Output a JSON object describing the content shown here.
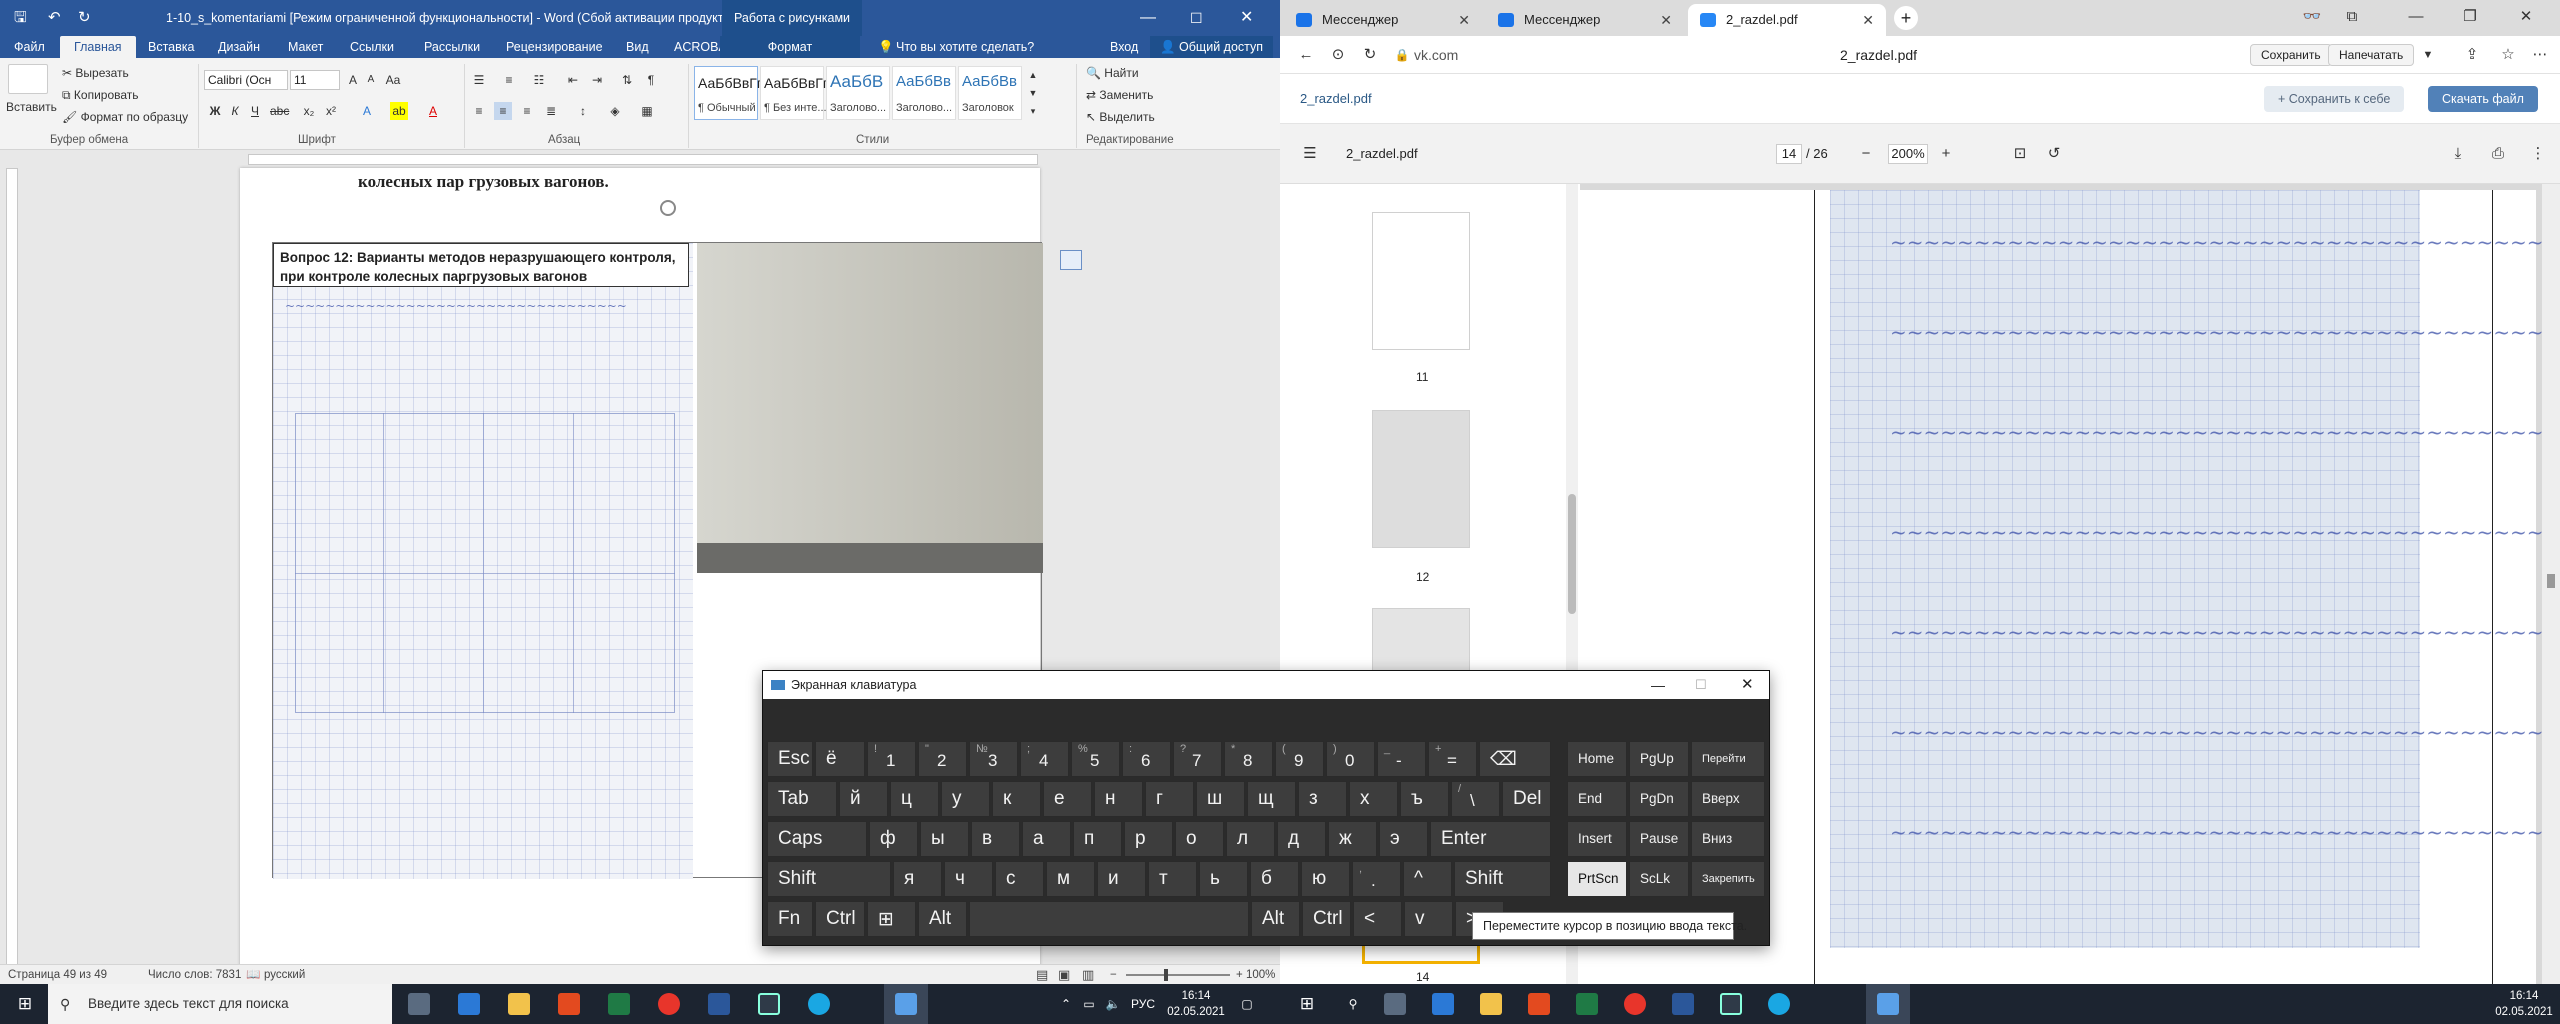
{
  "word": {
    "title": "1-10_s_komentariami [Режим ограниченной функциональности] - Word (Сбой активации продукта)",
    "context_tab": "Работа с рисунками",
    "context_format": "Формат",
    "tell_me": "Что вы хотите сделать?",
    "login": "Вход",
    "share": "Общий доступ",
    "tabs": [
      "Файл",
      "Главная",
      "Вставка",
      "Дизайн",
      "Макет",
      "Ссылки",
      "Рассылки",
      "Рецензирование",
      "Вид",
      "ACROBAT"
    ],
    "clipboard": {
      "paste": "Вставить",
      "cut": "Вырезать",
      "copy": "Копировать",
      "format_painter": "Формат по образцу",
      "group": "Буфер обмена"
    },
    "font": {
      "name": "Calibri (Осн",
      "size": "11",
      "group": "Шрифт"
    },
    "paragraph_group": "Абзац",
    "styles": {
      "items": [
        {
          "preview": "АаБбВвГг,",
          "name": "¶ Обычный"
        },
        {
          "preview": "АаБбВвГг,",
          "name": "¶ Без инте..."
        },
        {
          "preview": "АаБбВ",
          "name": "Заголово..."
        },
        {
          "preview": "АаБбВв",
          "name": "Заголово..."
        },
        {
          "preview": "АаБбВв",
          "name": "Заголовок"
        }
      ],
      "group": "Стили"
    },
    "editing": {
      "find": "Найти",
      "replace": "Заменить",
      "select": "Выделить",
      "group": "Редактирование"
    },
    "doc": {
      "heading": "колесных пар грузовых вагонов.",
      "box_text": "Вопрос  12: Варианты методов неразрушающего контроля, при контроле  колесных паргрузовых вагонов"
    },
    "status": {
      "page": "Страница 49 из 49",
      "words": "Число слов: 7831",
      "lang": "русский",
      "zoom": "100%"
    }
  },
  "edge": {
    "tabs": [
      {
        "label": "Мессенджер"
      },
      {
        "label": "Мессенджер"
      },
      {
        "label": "2_razdel.pdf"
      }
    ],
    "url": "vk.com",
    "page_title": "2_razdel.pdf",
    "save": "Сохранить",
    "print": "Напечатать",
    "vk_file": "2_razdel.pdf",
    "save_to_self": "Сохранить к себе",
    "download": "Скачать файл",
    "pdf": {
      "name": "2_razdel.pdf",
      "page": "14",
      "total": "/ 26",
      "zoom": "200%"
    },
    "thumbs": [
      "11",
      "12",
      "14"
    ]
  },
  "osk": {
    "title": "Экранная клавиатура",
    "row1": [
      {
        "m": "Esc"
      },
      {
        "m": "ё"
      },
      {
        "s": "!",
        "m": "1"
      },
      {
        "s": "\"",
        "m": "2"
      },
      {
        "s": "№",
        "m": "3"
      },
      {
        "s": ";",
        "m": "4"
      },
      {
        "s": "%",
        "m": "5"
      },
      {
        "s": ":",
        "m": "6"
      },
      {
        "s": "?",
        "m": "7"
      },
      {
        "s": "*",
        "m": "8"
      },
      {
        "s": "(",
        "m": "9"
      },
      {
        "s": ")",
        "m": "0"
      },
      {
        "s": "_",
        "m": "-"
      },
      {
        "s": "+",
        "m": "="
      },
      {
        "m": "⌫"
      }
    ],
    "row2": [
      {
        "m": "Tab"
      },
      {
        "m": "й"
      },
      {
        "m": "ц"
      },
      {
        "m": "у"
      },
      {
        "m": "к"
      },
      {
        "m": "е"
      },
      {
        "m": "н"
      },
      {
        "m": "г"
      },
      {
        "m": "ш"
      },
      {
        "m": "щ"
      },
      {
        "m": "з"
      },
      {
        "m": "х"
      },
      {
        "m": "ъ"
      },
      {
        "s": "/",
        "m": "\\"
      },
      {
        "m": "Del"
      }
    ],
    "row3": [
      {
        "m": "Caps"
      },
      {
        "m": "ф"
      },
      {
        "m": "ы"
      },
      {
        "m": "в"
      },
      {
        "m": "а"
      },
      {
        "m": "п"
      },
      {
        "m": "р"
      },
      {
        "m": "о"
      },
      {
        "m": "л"
      },
      {
        "m": "д"
      },
      {
        "m": "ж"
      },
      {
        "m": "э"
      },
      {
        "m": "Enter"
      }
    ],
    "row4": [
      {
        "m": "Shift"
      },
      {
        "m": "я"
      },
      {
        "m": "ч"
      },
      {
        "m": "с"
      },
      {
        "m": "м"
      },
      {
        "m": "и"
      },
      {
        "m": "т"
      },
      {
        "m": "ь"
      },
      {
        "m": "б"
      },
      {
        "m": "ю"
      },
      {
        "s": ",",
        "m": "."
      },
      {
        "m": "^"
      },
      {
        "m": "Shift"
      }
    ],
    "row5": [
      {
        "m": "Fn"
      },
      {
        "m": "Ctrl"
      },
      {
        "m": "⊞"
      },
      {
        "m": "Alt"
      },
      {
        "m": ""
      },
      {
        "m": "Alt"
      },
      {
        "m": "Ctrl"
      },
      {
        "m": "<"
      },
      {
        "m": "v"
      },
      {
        "m": ">"
      }
    ],
    "nav": [
      [
        "Home",
        "PgUp",
        "Перейти"
      ],
      [
        "End",
        "PgDn",
        "Вверх"
      ],
      [
        "Insert",
        "Pause",
        "Вниз"
      ],
      [
        "PrtScn",
        "ScLk",
        "Закрепить"
      ]
    ],
    "tooltip": "Переместите курсор в позицию ввода текста."
  },
  "taskbar": {
    "search": "Введите здесь текст для поиска",
    "lang": "РУС",
    "time": "16:14",
    "date": "02.05.2021"
  },
  "colors": {
    "word_blue": "#2b579a",
    "vk_blue": "#5181b8",
    "taskbar": "#1c2430"
  }
}
